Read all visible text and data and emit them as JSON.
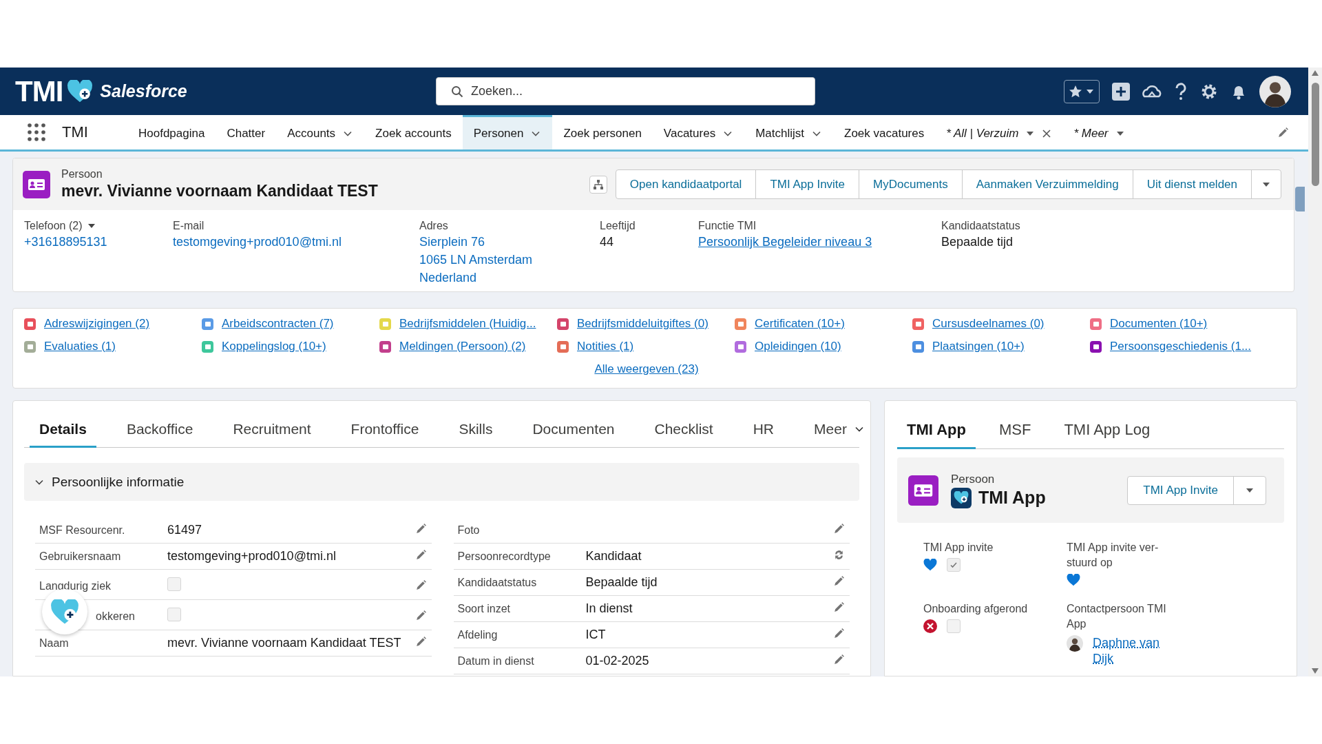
{
  "header": {
    "logo_text": "TMI",
    "brand": "Salesforce",
    "search": {
      "placeholder": "Zoeken..."
    }
  },
  "nav": {
    "app_name": "TMI",
    "items": [
      {
        "label": "Hoofdpagina",
        "selected": false,
        "dropdown": false,
        "italic": false,
        "closable": false
      },
      {
        "label": "Chatter",
        "selected": false,
        "dropdown": false,
        "italic": false,
        "closable": false
      },
      {
        "label": "Accounts",
        "selected": false,
        "dropdown": true,
        "italic": false,
        "closable": false
      },
      {
        "label": "Zoek accounts",
        "selected": false,
        "dropdown": false,
        "italic": false,
        "closable": false
      },
      {
        "label": "Personen",
        "selected": true,
        "dropdown": true,
        "italic": false,
        "closable": false
      },
      {
        "label": "Zoek personen",
        "selected": false,
        "dropdown": false,
        "italic": false,
        "closable": false
      },
      {
        "label": "Vacatures",
        "selected": false,
        "dropdown": true,
        "italic": false,
        "closable": false
      },
      {
        "label": "Matchlijst",
        "selected": false,
        "dropdown": true,
        "italic": false,
        "closable": false
      },
      {
        "label": "Zoek vacatures",
        "selected": false,
        "dropdown": false,
        "italic": false,
        "closable": false
      },
      {
        "label": "* All | Verzuim",
        "selected": false,
        "dropdown": true,
        "italic": true,
        "closable": true
      },
      {
        "label": "* Meer",
        "selected": false,
        "dropdown": true,
        "italic": true,
        "closable": false
      }
    ]
  },
  "record": {
    "object": "Persoon",
    "title": "mevr. Vivianne voornaam Kandidaat TEST",
    "actions": [
      "Open kandidaatportal",
      "TMI App Invite",
      "MyDocuments",
      "Aanmaken Verzuimmelding",
      "Uit dienst melden"
    ],
    "fields": [
      {
        "label": "Telefoon (2)",
        "kind": "link",
        "dropdown": true,
        "values": [
          "+31618895131"
        ]
      },
      {
        "label": "E-mail",
        "kind": "link",
        "dropdown": false,
        "values": [
          "testomgeving+prod010@tmi.nl"
        ]
      },
      {
        "label": "Adres",
        "kind": "link",
        "dropdown": false,
        "values": [
          "Sierplein 76",
          "1065 LN Amsterdam",
          "Nederland"
        ]
      },
      {
        "label": "Leeftijd",
        "kind": "text",
        "dropdown": false,
        "values": [
          "44"
        ]
      },
      {
        "label": "Functie TMI",
        "kind": "lookup",
        "dropdown": false,
        "values": [
          "Persoonlijk Begeleider niveau 3"
        ]
      },
      {
        "label": "Kandidaatstatus",
        "kind": "text",
        "dropdown": false,
        "values": [
          "Bepaalde tijd"
        ]
      }
    ]
  },
  "related_lists": {
    "items": [
      {
        "label": "Adreswijzigingen (2)",
        "color": "#e8505b"
      },
      {
        "label": "Arbeidscontracten (7)",
        "color": "#5a9be6"
      },
      {
        "label": "Bedrijfsmiddelen (Huidig...",
        "color": "#e4d84a"
      },
      {
        "label": "Bedrijfsmiddeluitgiftes (0)",
        "color": "#d4446a"
      },
      {
        "label": "Certificaten (10+)",
        "color": "#f0855c"
      },
      {
        "label": "Cursusdeelnames (0)",
        "color": "#f06262"
      },
      {
        "label": "Documenten (10+)",
        "color": "#ef6e85"
      },
      {
        "label": "Evaluaties (1)",
        "color": "#a3ad98"
      },
      {
        "label": "Koppelingslog (10+)",
        "color": "#3ec79c"
      },
      {
        "label": "Meldingen (Persoon) (2)",
        "color": "#c23f8c"
      },
      {
        "label": "Notities (1)",
        "color": "#e46d57"
      },
      {
        "label": "Opleidingen (10)",
        "color": "#b16cde"
      },
      {
        "label": "Plaatsingen (10+)",
        "color": "#4d8fe0"
      },
      {
        "label": "Persoonsgeschiedenis (1...",
        "color": "#8a10b0"
      }
    ],
    "show_all": "Alle weergeven (23)"
  },
  "details": {
    "tabs": [
      {
        "label": "Details",
        "selected": true,
        "dropdown": false
      },
      {
        "label": "Backoffice",
        "selected": false,
        "dropdown": false
      },
      {
        "label": "Recruitment",
        "selected": false,
        "dropdown": false
      },
      {
        "label": "Frontoffice",
        "selected": false,
        "dropdown": false
      },
      {
        "label": "Skills",
        "selected": false,
        "dropdown": false
      },
      {
        "label": "Documenten",
        "selected": false,
        "dropdown": false
      },
      {
        "label": "Checklist",
        "selected": false,
        "dropdown": false
      },
      {
        "label": "HR",
        "selected": false,
        "dropdown": false
      },
      {
        "label": "Meer",
        "selected": false,
        "dropdown": true
      }
    ],
    "section": {
      "title": "Persoonlijke informatie",
      "expanded": true
    },
    "left_fields": [
      {
        "label": "MSF Resourcenr.",
        "kind": "text",
        "value": "61497"
      },
      {
        "label": "Gebruikersnaam",
        "kind": "text",
        "value": "testomgeving+prod010@tmi.nl"
      },
      {
        "label": "Langdurig ziek",
        "kind": "checkbox",
        "checked": false
      },
      {
        "label": "okkeren",
        "kind": "checkbox",
        "checked": false
      },
      {
        "label": "Naam",
        "kind": "text",
        "value": "mevr. Vivianne voornaam Kandidaat TEST"
      }
    ],
    "right_fields": [
      {
        "label": "Foto",
        "kind": "text"
      },
      {
        "label": "Persoonrecordtype",
        "kind": "record_type",
        "value": "Kandidaat"
      },
      {
        "label": "Kandidaatstatus",
        "kind": "text",
        "value": "Bepaalde tijd"
      },
      {
        "label": "Soort inzet",
        "kind": "text",
        "value": "In dienst"
      },
      {
        "label": "Afdeling",
        "kind": "text",
        "value": "ICT"
      },
      {
        "label": "Datum in dienst",
        "kind": "text",
        "value": "01-02-2025"
      }
    ]
  },
  "side": {
    "tabs": [
      {
        "label": "TMI App",
        "selected": true
      },
      {
        "label": "MSF",
        "selected": false
      },
      {
        "label": "TMI App Log",
        "selected": false
      }
    ],
    "object": "Persoon",
    "title": "TMI App",
    "action": "TMI App Invite",
    "fields": [
      {
        "label": "TMI App invite",
        "kind": "status_checkbox",
        "ok": true,
        "checked": true
      },
      {
        "label": "TMI App invite ver-stuurd op",
        "kind": "status",
        "ok": true
      },
      {
        "label": "Onboarding afgerond",
        "kind": "status_checkbox",
        "ok": false,
        "checked": false
      },
      {
        "label": "Contactpersoon TMI App",
        "kind": "user",
        "value": "Daphne van Dijk"
      }
    ]
  }
}
